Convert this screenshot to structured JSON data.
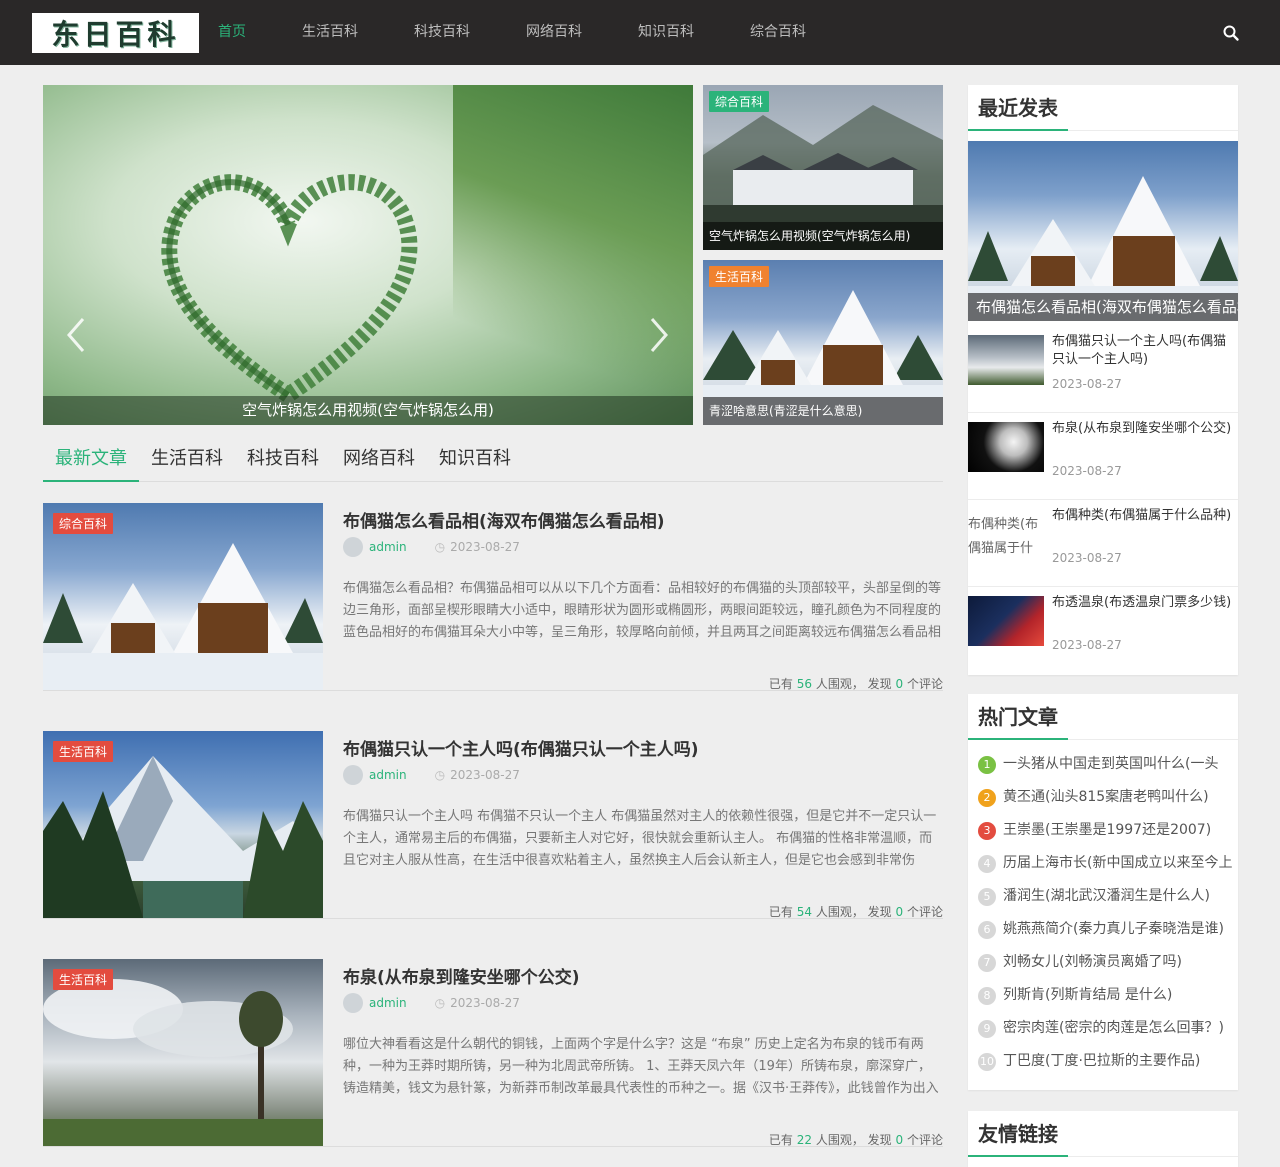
{
  "site": {
    "logo_text": "东日百科"
  },
  "nav": {
    "items": [
      {
        "label": "首页"
      },
      {
        "label": "生活百科"
      },
      {
        "label": "科技百科"
      },
      {
        "label": "网络百科"
      },
      {
        "label": "知识百科"
      },
      {
        "label": "综合百科"
      }
    ],
    "active_index": 0
  },
  "slider": {
    "caption": "空气炸锅怎么用视频(空气炸锅怎么用)"
  },
  "features": [
    {
      "tag": "综合百科",
      "caption": "空气炸锅怎么用视频(空气炸锅怎么用)"
    },
    {
      "tag": "生活百科",
      "caption": "青涩啥意思(青涩是什么意思)"
    }
  ],
  "tabs": [
    {
      "label": "最新文章"
    },
    {
      "label": "生活百科"
    },
    {
      "label": "科技百科"
    },
    {
      "label": "网络百科"
    },
    {
      "label": "知识百科"
    }
  ],
  "posts": [
    {
      "tag": "综合百科",
      "title": "布偶猫怎么看品相(海双布偶猫怎么看品相)",
      "author": "admin",
      "date": "2023-08-27",
      "excerpt": "布偶猫怎么看品相？布偶猫品相可以从以下几个方面看：品相较好的布偶猫的头顶部较平，头部呈倒的等边三角形，面部呈楔形眼睛大小适中，眼睛形状为圆形或椭圆形，两眼间距较远，瞳孔颜色为不同程度的蓝色品相好的布偶猫耳朵大小中等，呈三角形，较厚略向前倾，并且两耳之间距离较远布偶猫怎么看品相",
      "stats_prefix": "已有",
      "views": "56",
      "stats_mid": "人围观， 发现",
      "comments": "0",
      "stats_suffix": "个评论"
    },
    {
      "tag": "生活百科",
      "title": "布偶猫只认一个主人吗(布偶猫只认一个主人吗)",
      "author": "admin",
      "date": "2023-08-27",
      "excerpt": "布偶猫只认一个主人吗 布偶猫不只认一个主人 布偶猫虽然对主人的依赖性很强，但是它并不一定只认一个主人，通常易主后的布偶猫，只要新主人对它好，很快就会重新认主人。 布偶猫的性格非常温顺，而且它对主人服从性高，在生活中很喜欢粘着主人，虽然换主人后会认新主人，但是它也会感到非常伤",
      "stats_prefix": "已有",
      "views": "54",
      "stats_mid": "人围观， 发现",
      "comments": "0",
      "stats_suffix": "个评论"
    },
    {
      "tag": "生活百科",
      "title": "布泉(从布泉到隆安坐哪个公交)",
      "author": "admin",
      "date": "2023-08-27",
      "excerpt": "哪位大神看看这是什么朝代的铜钱，上面两个字是什么字？这是 “布泉” 历史上定名为布泉的钱币有两种，一种为王莽时期所铸，另一种为北周武帝所铸。 1、王莽天凤六年（19年）所铸布泉，廓深穿广，铸造精美，钱文为悬针篆，为新莽币制改革最具代表性的币种之一。据《汉书·王莽传》，此钱曾作为出入",
      "stats_prefix": "已有",
      "views": "22",
      "stats_mid": "人围观， 发现",
      "comments": "0",
      "stats_suffix": "个评论"
    }
  ],
  "recent": {
    "title": "最近发表",
    "hero_caption": "布偶猫怎么看品相(海双布偶猫怎么看品相)",
    "items": [
      {
        "title": "布偶猫只认一个主人吗(布偶猫只认一个主人吗)",
        "date": "2023-08-27"
      },
      {
        "title": "布泉(从布泉到隆安坐哪个公交)",
        "date": "2023-08-27"
      },
      {
        "alt": "布偶种类(布偶猫属于什么品种)",
        "title": "布偶种类(布偶猫属于什么品种)",
        "date": "2023-08-27"
      },
      {
        "title": "布透温泉(布透温泉门票多少钱)",
        "date": "2023-08-27"
      }
    ]
  },
  "hot": {
    "title": "热门文章",
    "items": [
      {
        "num": "1",
        "title": "一头猪从中国走到英国叫什么(一头"
      },
      {
        "num": "2",
        "title": "黄丕通(汕头815案唐老鸭叫什么)"
      },
      {
        "num": "3",
        "title": "王崇墨(王崇墨是1997还是2007)"
      },
      {
        "num": "4",
        "title": "历届上海市长(新中国成立以来至今上"
      },
      {
        "num": "5",
        "title": "潘润生(湖北武汉潘润生是什么人)"
      },
      {
        "num": "6",
        "title": "姚燕燕简介(秦力真儿子秦晓浩是谁)"
      },
      {
        "num": "7",
        "title": "刘畅女儿(刘畅演员离婚了吗)"
      },
      {
        "num": "8",
        "title": "列斯肯(列斯肯结局 是什么)"
      },
      {
        "num": "9",
        "title": "密宗肉莲(密宗的肉莲是怎么回事？)"
      },
      {
        "num": "10",
        "title": "丁巴度(丁度·巴拉斯的主要作品)"
      }
    ]
  },
  "links": {
    "title": "友情链接"
  },
  "colors": {
    "accent": "#2bb37a",
    "header_bg": "#2a2828",
    "tag_green": "#2bb37a",
    "tag_red": "#e34c3f"
  }
}
